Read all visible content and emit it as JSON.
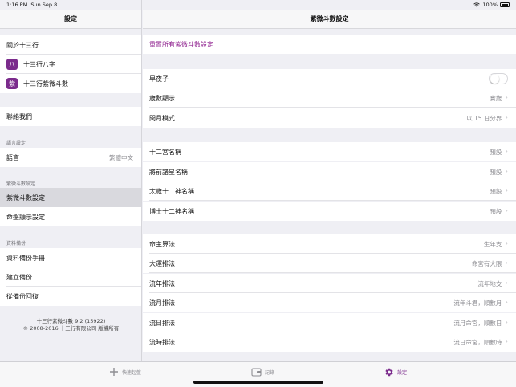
{
  "status": {
    "time": "1:16 PM",
    "date": "Sun Sep 8",
    "battery": "100%"
  },
  "sidebar": {
    "title": "設定",
    "group1": [
      {
        "label": "關於十三行"
      },
      {
        "label": "十三行八字",
        "icon_glyph": "八"
      },
      {
        "label": "十三行紫微斗數",
        "icon_glyph": "紫"
      }
    ],
    "contact": "聯絡我們",
    "lang_section": "語言設定",
    "lang_label": "語言",
    "lang_value": "繁體中文",
    "ziwei_section": "紫微斗數設定",
    "ziwei_items": [
      "紫微斗數設定",
      "命盤顯示設定"
    ],
    "backup_section": "資料備份",
    "backup_items": [
      "資料備份手冊",
      "建立備份",
      "從備份回復"
    ],
    "footer_line1": "十三行紫微斗數 9.2 (15922)",
    "footer_line2": "© 2008-2016 十三行有限公司 版權所有"
  },
  "detail": {
    "title": "紫微斗數設定",
    "reset": "重置所有紫微斗數設定",
    "group1": [
      {
        "label": "早夜子",
        "toggle": false
      },
      {
        "label": "歲數顯示",
        "value": "實歲"
      },
      {
        "label": "閏月模式",
        "value": "以 15 日分界"
      }
    ],
    "group2": [
      {
        "label": "十二宮名稱",
        "value": "預設"
      },
      {
        "label": "將前諸星名稱",
        "value": "預設"
      },
      {
        "label": "太歲十二神名稱",
        "value": "預設"
      },
      {
        "label": "博士十二神名稱",
        "value": "預設"
      }
    ],
    "group3": [
      {
        "label": "命主算法",
        "value": "生年支"
      },
      {
        "label": "大運排法",
        "value": "命宮有大限"
      },
      {
        "label": "流年排法",
        "value": "流年地支"
      },
      {
        "label": "流月排法",
        "value": "流年斗君，順數月"
      },
      {
        "label": "流日排法",
        "value": "流月命宮，順數日"
      },
      {
        "label": "流時排法",
        "value": "流日命宮，順數時"
      }
    ]
  },
  "tabbar": [
    {
      "label": "快速起盤",
      "icon": "plus-icon"
    },
    {
      "label": "記錄",
      "icon": "wallet-icon"
    },
    {
      "label": "設定",
      "icon": "gear-icon",
      "active": true
    }
  ],
  "colors": {
    "accent": "#7b2b8c",
    "link": "#8e1f8e"
  }
}
